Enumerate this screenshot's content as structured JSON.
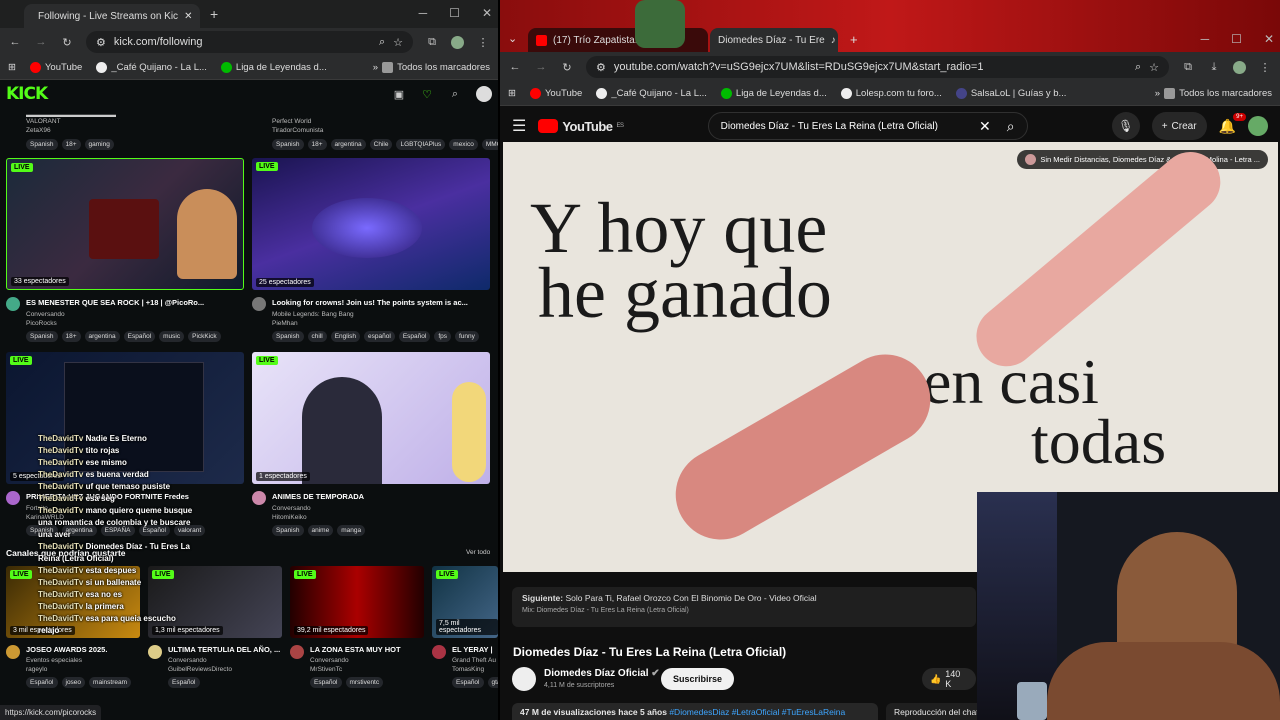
{
  "left_browser": {
    "tab_title": "Following - Live Streams on Kic",
    "url": "kick.com/following",
    "status_url": "https://kick.com/picorocks",
    "bookmarks": [
      "YouTube",
      "_Café Quijano - La L...",
      "Liga de Leyendas d...",
      "Todos los marcadores"
    ]
  },
  "kick": {
    "logo": "KICK",
    "top_row": [
      {
        "channel": "ZetaX96",
        "category": "VALORANT",
        "tags": [
          "Spanish",
          "18+",
          "gaming"
        ]
      },
      {
        "channel": "TiradorComunista",
        "category": "Perfect World",
        "tags": [
          "Spanish",
          "18+",
          "argentina",
          "Chile",
          "LGBTQIAPlus",
          "mexico",
          "MMO"
        ]
      }
    ],
    "cards": [
      {
        "viewers": "33 espectadores",
        "title": "ES MENESTER QUE SEA ROCK | +18 | @PicoRo...",
        "category": "Conversando",
        "channel": "PicoRocks",
        "tags": [
          "Spanish",
          "18+",
          "argentina",
          "Español",
          "music",
          "PickKick"
        ],
        "live": "LIVE"
      },
      {
        "viewers": "25 espectadores",
        "title": "Looking for crowns! Join us! The points system is ac...",
        "category": "Mobile Legends: Bang Bang",
        "channel": "PieMhan",
        "tags": [
          "Spanish",
          "chill",
          "English",
          "español",
          "Español",
          "fps",
          "funny"
        ],
        "live": "LIVE"
      },
      {
        "viewers": "5 espectadores",
        "title": "PRIMERITA VEZ JUGANDO FORTNITE Fredes",
        "category": "Fortnite",
        "channel": "KarinaWRLD",
        "tags": [
          "Spanish",
          "argentina",
          "ESPAÑA",
          "Español",
          "valorant"
        ],
        "live": "LIVE"
      },
      {
        "viewers": "1 espectadores",
        "title": "ANIMES DE TEMPORADA",
        "category": "Conversando",
        "channel": "HitomiKeiko",
        "tags": [
          "Spanish",
          "anime",
          "manga"
        ],
        "live": "LIVE"
      }
    ],
    "suggested_heading": "Canales que podrían gustarte",
    "see_all": "Ver todo",
    "suggested": [
      {
        "viewers": "3 mil espectadores",
        "title": "JOSEO AWARDS 2025.",
        "category": "Eventos especiales",
        "channel": "rageylo",
        "tags": [
          "Español",
          "joseo",
          "mainstream"
        ]
      },
      {
        "viewers": "1,3 mil espectadores",
        "title": "ULTIMA TERTULIA DEL AÑO, ...",
        "category": "Conversando",
        "channel": "GuibelReviewsDirecto",
        "tags": [
          "Español"
        ]
      },
      {
        "viewers": "39,2 mil espectadores",
        "title": "LA ZONA ESTA MUY HOT",
        "category": "Conversando",
        "channel": "MrStivenTc",
        "tags": [
          "Español",
          "mrstiventc"
        ]
      },
      {
        "viewers": "7,5 mil espectadores",
        "title": "EL YERAY |",
        "category": "Grand Theft Au",
        "channel": "TomasKing",
        "tags": [
          "Español",
          "gta"
        ]
      }
    ]
  },
  "chat_overlay": [
    {
      "user": "TheDavidTv",
      "msg": "Nadie Es Eterno"
    },
    {
      "user": "TheDavidTv",
      "msg": "tito rojas"
    },
    {
      "user": "TheDavidTv",
      "msg": "ese mismo"
    },
    {
      "user": "TheDavidTv",
      "msg": "es buena verdad"
    },
    {
      "user": "TheDavidTv",
      "msg": "uf que temaso pusiste"
    },
    {
      "user": "TheDavidTv",
      "msg": "esa seg"
    },
    {
      "user": "TheDavidTv",
      "msg": "mano quiero queme busque una romantica de colombia y te buscare una aver"
    },
    {
      "user": "TheDavidTv",
      "msg": "Diomedes Díaz - Tu Eres La Reina (Letra Oficial)"
    },
    {
      "user": "TheDavidTv",
      "msg": "esta despues"
    },
    {
      "user": "TheDavidTv",
      "msg": "si un ballenate"
    },
    {
      "user": "TheDavidTv",
      "msg": "esa no es"
    },
    {
      "user": "TheDavidTv",
      "msg": "la primera"
    },
    {
      "user": "TheDavidTv",
      "msg": "esa para queia escucho relajo"
    }
  ],
  "right_browser": {
    "tab_title": "(17) Trío Zapatista...",
    "tab_title2": "Diomedes Díaz - Tu Ere",
    "url": "youtube.com/watch?v=uSG9ejcx7UM&list=RDuSG9ejcx7UM&start_radio=1",
    "bookmarks": [
      "YouTube",
      "_Café Quijano - La L...",
      "Liga de Leyendas d...",
      "Lolesp.com tu foro...",
      "SalsaLoL | Guías y b...",
      "Todos los marcadores"
    ]
  },
  "youtube": {
    "logo": "YouTube",
    "region": "ES",
    "search_value": "Diomedes Díaz - Tu Eres La Reina (Letra Oficial)",
    "create": "Crear",
    "notif_count": "9+",
    "playlist_chip": "Sin Medir Distancias, Diomedes Díaz & El Cocha Molina - Letra ...",
    "lyric_1": "Y hoy que",
    "lyric_2": "he ganado",
    "lyric_3": "en casi",
    "lyric_4": "todas",
    "next_label": "Siguiente:",
    "next_title": "Solo Para Ti, Rafael Orozco Con El Binomio De Oro - Video Oficial",
    "next_mix": "Mix: Diomedes Díaz - Tu Eres La Reina (Letra Oficial)",
    "video_title": "Diomedes Díaz - Tu Eres La Reina (Letra Oficial)",
    "channel": "Diomedes Díaz Oficial",
    "subscribers": "4,11 M de suscriptores",
    "subscribe": "Suscribirse",
    "likes": "140 K",
    "views": "47 M de visualizaciones",
    "age": "hace 5 años",
    "hashtags": "#DiomedesDiaz #LetraOficial #TuEresLaReina",
    "autoplay_label": "Reproducción del chat"
  }
}
